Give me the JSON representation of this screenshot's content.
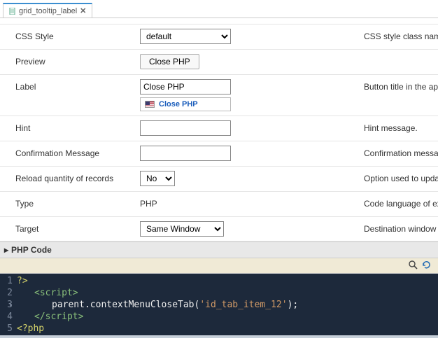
{
  "tab": {
    "title": "grid_tooltip_label",
    "close": "✕"
  },
  "rows": {
    "css_style": {
      "label": "CSS Style",
      "value": "default",
      "desc": "CSS style class nam"
    },
    "preview": {
      "label": "Preview",
      "button": "Close PHP",
      "desc": ""
    },
    "label": {
      "label": "Label",
      "value": "Close PHP",
      "lang": "Close PHP",
      "desc": "Button title in the ap"
    },
    "hint": {
      "label": "Hint",
      "value": "",
      "desc": "Hint message."
    },
    "confirm": {
      "label": "Confirmation Message",
      "value": "",
      "desc": "Confirmation messa"
    },
    "reload": {
      "label": "Reload quantity of records",
      "value": "No",
      "desc": "Option used to upda"
    },
    "type": {
      "label": "Type",
      "value": "PHP",
      "desc": "Code language of ex"
    },
    "target": {
      "label": "Target",
      "value": "Same Window",
      "desc": "Destination window"
    }
  },
  "section": {
    "title": "PHP Code",
    "caret": "▸"
  },
  "code": {
    "lines": [
      "?>",
      "<script>",
      "parent.contextMenuCloseTab('id_tab_item_12');",
      "</script>",
      "<?php"
    ]
  }
}
